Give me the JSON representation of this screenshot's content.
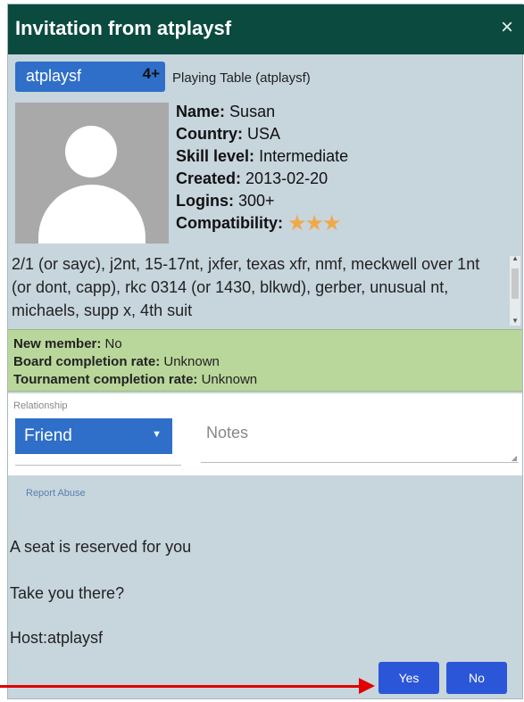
{
  "dialog": {
    "title": "Invitation from atplaysf",
    "close_symbol": "×"
  },
  "user": {
    "name": "atplaysf",
    "level": "4+",
    "table_label": "Playing Table (atplaysf)"
  },
  "profile": {
    "name_label": "Name:",
    "name_value": "Susan",
    "country_label": "Country:",
    "country_value": "USA",
    "skill_label": "Skill level:",
    "skill_value": "Intermediate",
    "created_label": "Created:",
    "created_value": "2013-02-20",
    "logins_label": "Logins:",
    "logins_value": "300+",
    "compat_label": "Compatibility:",
    "compat_stars": "★★★",
    "conventions": "2/1 (or sayc), j2nt, 15-17nt, jxfer, texas xfr, nmf, meckwell over 1nt (or dont, capp), rkc 0314 (or 1430, blkwd), gerber, unusual nt, michaels, supp x, 4th suit"
  },
  "stats": {
    "new_member_label": "New member:",
    "new_member_value": "No",
    "board_label": "Board completion rate:",
    "board_value": "Unknown",
    "tournament_label": "Tournament completion rate:",
    "tournament_value": "Unknown"
  },
  "relationship": {
    "label": "Relationship",
    "value": "Friend",
    "notes_placeholder": "Notes"
  },
  "report_abuse": "Report Abuse",
  "messages": {
    "seat": "A seat is reserved for you",
    "question": "Take you there?",
    "host": "Host:atplaysf"
  },
  "buttons": {
    "yes": "Yes",
    "no": "No"
  },
  "colors": {
    "titlebar": "#0b4a3e",
    "dialog_bg": "#c7d5dd",
    "accent_blue": "#2f6fc9",
    "stats_green": "#b9d79b",
    "annotation_arrow": "#e00000"
  }
}
